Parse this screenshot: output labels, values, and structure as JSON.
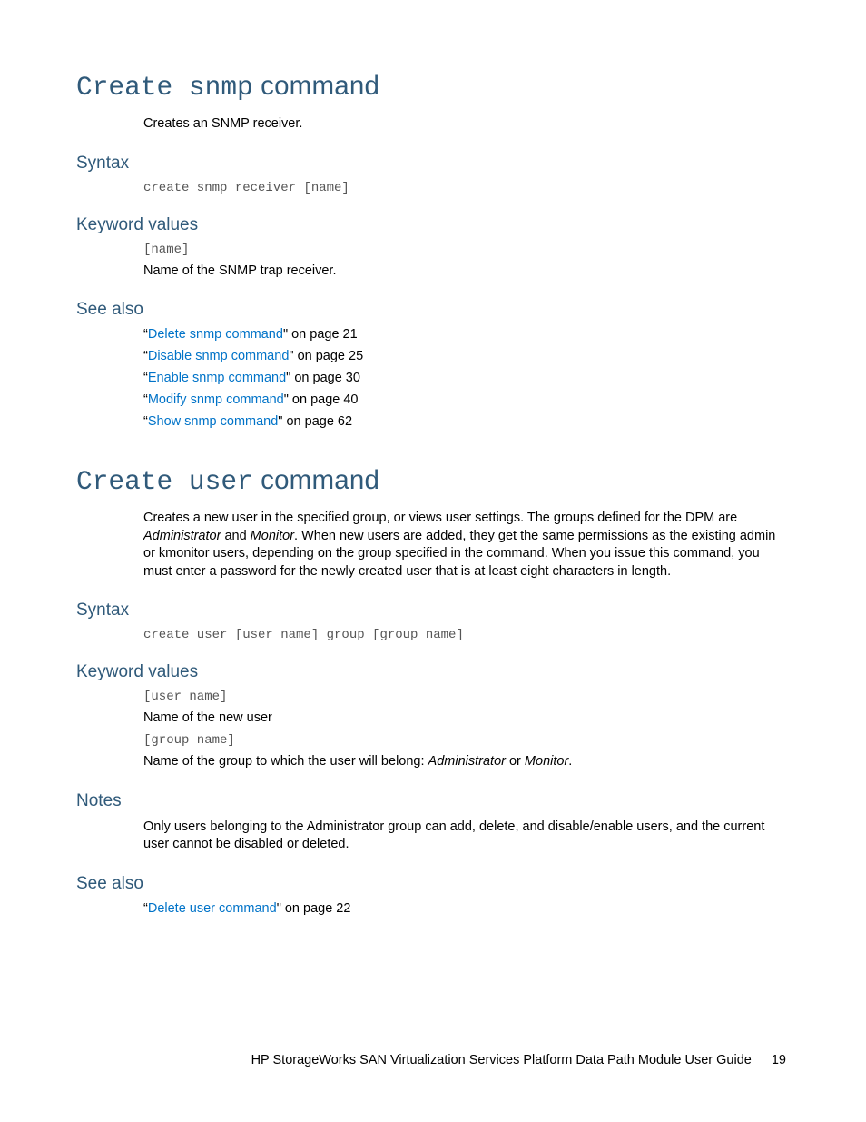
{
  "sec1": {
    "title_mono": "Create snmp",
    "title_rest": " command",
    "desc": "Creates an SNMP receiver.",
    "h_syntax": "Syntax",
    "syntax": "create snmp receiver [name]",
    "h_kv": "Keyword values",
    "kv_param": "[name]",
    "kv_desc": "Name of the SNMP trap receiver.",
    "h_seealso": "See also",
    "see": [
      {
        "link": "Delete snmp command",
        "tail": "\" on page 21"
      },
      {
        "link": "Disable snmp command",
        "tail": "\" on page 25"
      },
      {
        "link": "Enable snmp command",
        "tail": "\" on page 30"
      },
      {
        "link": "Modify snmp command",
        "tail": "\" on page 40"
      },
      {
        "link": "Show snmp command",
        "tail": "\" on page 62"
      }
    ]
  },
  "sec2": {
    "title_mono": "Create user",
    "title_rest": " command",
    "desc_a": "Creates a new user in the specified group, or views user settings. The groups defined for the DPM are ",
    "desc_em1": "Administrator",
    "desc_b": " and ",
    "desc_em2": "Monitor",
    "desc_c": ". When new users are added, they get the same permissions as the existing admin or kmonitor users, depending on the group specified in the command. When you issue this command, you must enter a password for the newly created user that is at least eight characters in length.",
    "h_syntax": "Syntax",
    "syntax": "create user [user name] group [group name]",
    "h_kv": "Keyword values",
    "kv1_param": "[user name]",
    "kv1_desc": "Name of the new user",
    "kv2_param": "[group name]",
    "kv2_desc_a": "Name of the group to which the user will belong: ",
    "kv2_em1": "Administrator",
    "kv2_desc_b": " or ",
    "kv2_em2": "Monitor",
    "kv2_desc_c": ".",
    "h_notes": "Notes",
    "notes": "Only users belonging to the Administrator group can add, delete, and disable/enable users, and the current user cannot be disabled or deleted.",
    "h_seealso": "See also",
    "see": [
      {
        "link": "Delete user command",
        "tail": "\" on page 22"
      }
    ]
  },
  "footer": {
    "text": "HP StorageWorks SAN Virtualization Services Platform Data Path Module User Guide",
    "page": "19"
  }
}
